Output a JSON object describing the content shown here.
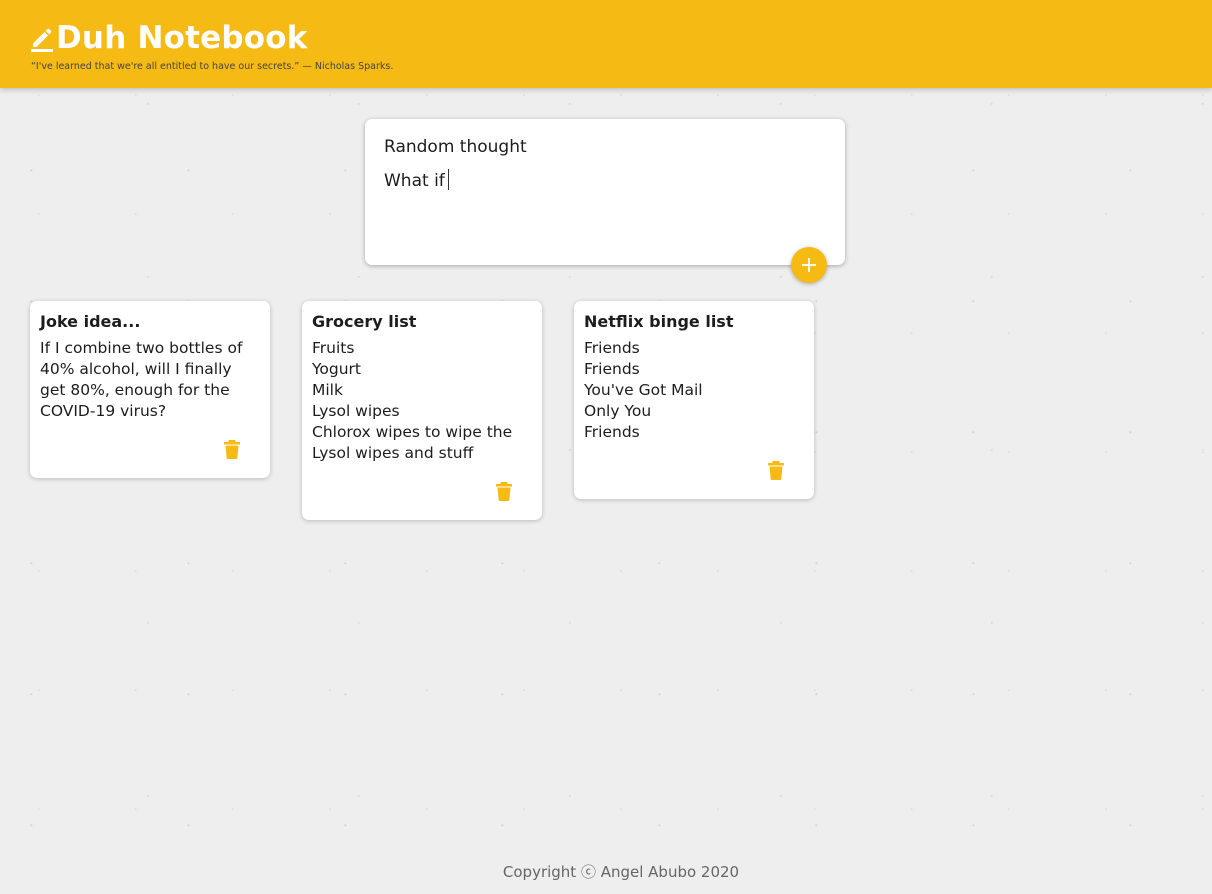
{
  "header": {
    "title": "Duh Notebook",
    "tagline": "“I've learned that we're all entitled to have our secrets.” — Nicholas Sparks."
  },
  "create_note": {
    "title_value": "Random thought",
    "content_value": "What if",
    "add_icon": "plus-icon"
  },
  "notes": [
    {
      "title": "Joke idea...",
      "content": "If I combine two bottles of 40% alcohol, will I finally get 80%, enough for the COVID-19 virus?",
      "delete_icon": "trash-icon"
    },
    {
      "title": "Grocery list",
      "content": "Fruits\nYogurt\nMilk\nLysol wipes\nChlorox wipes to wipe the Lysol wipes and stuff",
      "delete_icon": "trash-icon"
    },
    {
      "title": "Netflix binge list",
      "content": "Friends\nFriends\nYou've Got Mail\nOnly You\nFriends",
      "delete_icon": "trash-icon"
    }
  ],
  "footer": {
    "text": "Copyright ⓒ Angel Abubo 2020"
  },
  "colors": {
    "accent": "#f5ba13",
    "header_text": "#ffffff",
    "background": "#eeeeee"
  }
}
